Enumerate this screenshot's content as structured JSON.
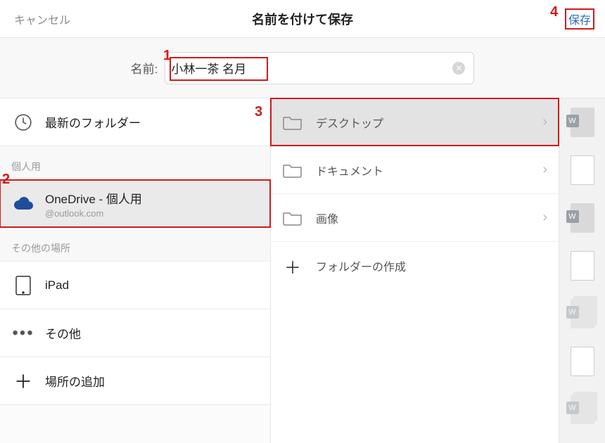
{
  "header": {
    "cancel": "キャンセル",
    "title": "名前を付けて保存",
    "save": "保存"
  },
  "name_row": {
    "label": "名前:",
    "value": "小林一茶 名月"
  },
  "left": {
    "recent": "最新のフォルダー",
    "section_personal": "個人用",
    "onedrive_title": "OneDrive - 個人用",
    "onedrive_sub": "@outlook.com",
    "section_other": "その他の場所",
    "ipad": "iPad",
    "more": "その他",
    "add": "場所の追加"
  },
  "mid": {
    "desktop": "デスクトップ",
    "documents": "ドキュメント",
    "pictures": "画像",
    "newfolder": "フォルダーの作成"
  },
  "callouts": {
    "c1": "1",
    "c2": "2",
    "c3": "3",
    "c4": "4"
  }
}
